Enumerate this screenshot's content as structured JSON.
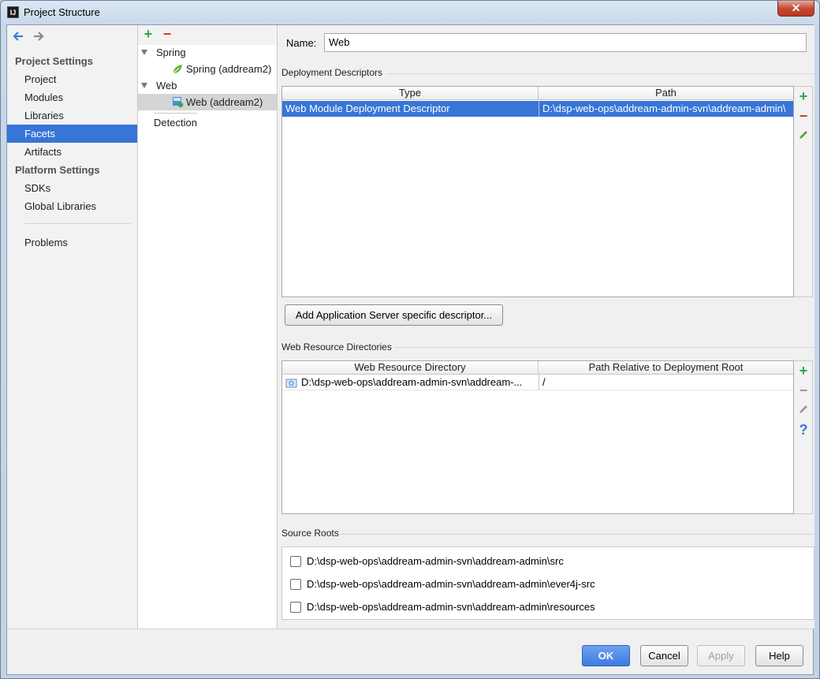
{
  "window": {
    "title": "Project Structure",
    "icon_text": "IJ",
    "close_label": "✕"
  },
  "nav": {
    "project_settings_label": "Project Settings",
    "platform_settings_label": "Platform Settings",
    "items": [
      "Project",
      "Modules",
      "Libraries",
      "Facets",
      "Artifacts"
    ],
    "platform_items": [
      "SDKs",
      "Global Libraries"
    ],
    "problems_label": "Problems",
    "selected": "Facets"
  },
  "tree": {
    "add_icon": "+",
    "remove_icon": "−",
    "nodes": [
      {
        "label": "Spring",
        "level": 0
      },
      {
        "label": "Spring (addream2)",
        "level": 1
      },
      {
        "label": "Web",
        "level": 0
      },
      {
        "label": "Web (addream2)",
        "level": 1
      }
    ],
    "detection_label": "Detection"
  },
  "main": {
    "name_label": "Name:",
    "name_value": "Web",
    "deployment_title": "Deployment Descriptors",
    "deployment_columns": [
      "Type",
      "Path"
    ],
    "deployment_rows": [
      {
        "type": "Web Module Deployment Descriptor",
        "path": "D:\\dsp-web-ops\\addream-admin-svn\\addream-admin\\"
      }
    ],
    "add_server_button": "Add Application Server specific descriptor...",
    "web_resource_title": "Web Resource Directories",
    "web_resource_columns": [
      "Web Resource Directory",
      "Path Relative to Deployment Root"
    ],
    "web_resource_rows": [
      {
        "directory": "D:\\dsp-web-ops\\addream-admin-svn\\addream-...",
        "relative": "/"
      }
    ],
    "source_roots_title": "Source Roots",
    "source_roots": [
      "D:\\dsp-web-ops\\addream-admin-svn\\addream-admin\\src",
      "D:\\dsp-web-ops\\addream-admin-svn\\addream-admin\\ever4j-src",
      "D:\\dsp-web-ops\\addream-admin-svn\\addream-admin\\resources"
    ]
  },
  "footer": {
    "ok": "OK",
    "cancel": "Cancel",
    "apply": "Apply",
    "help": "Help"
  },
  "colors": {
    "selection": "#3875d7",
    "add": "#2ea44f",
    "remove": "#d9342b",
    "help": "#3a7fd5"
  }
}
